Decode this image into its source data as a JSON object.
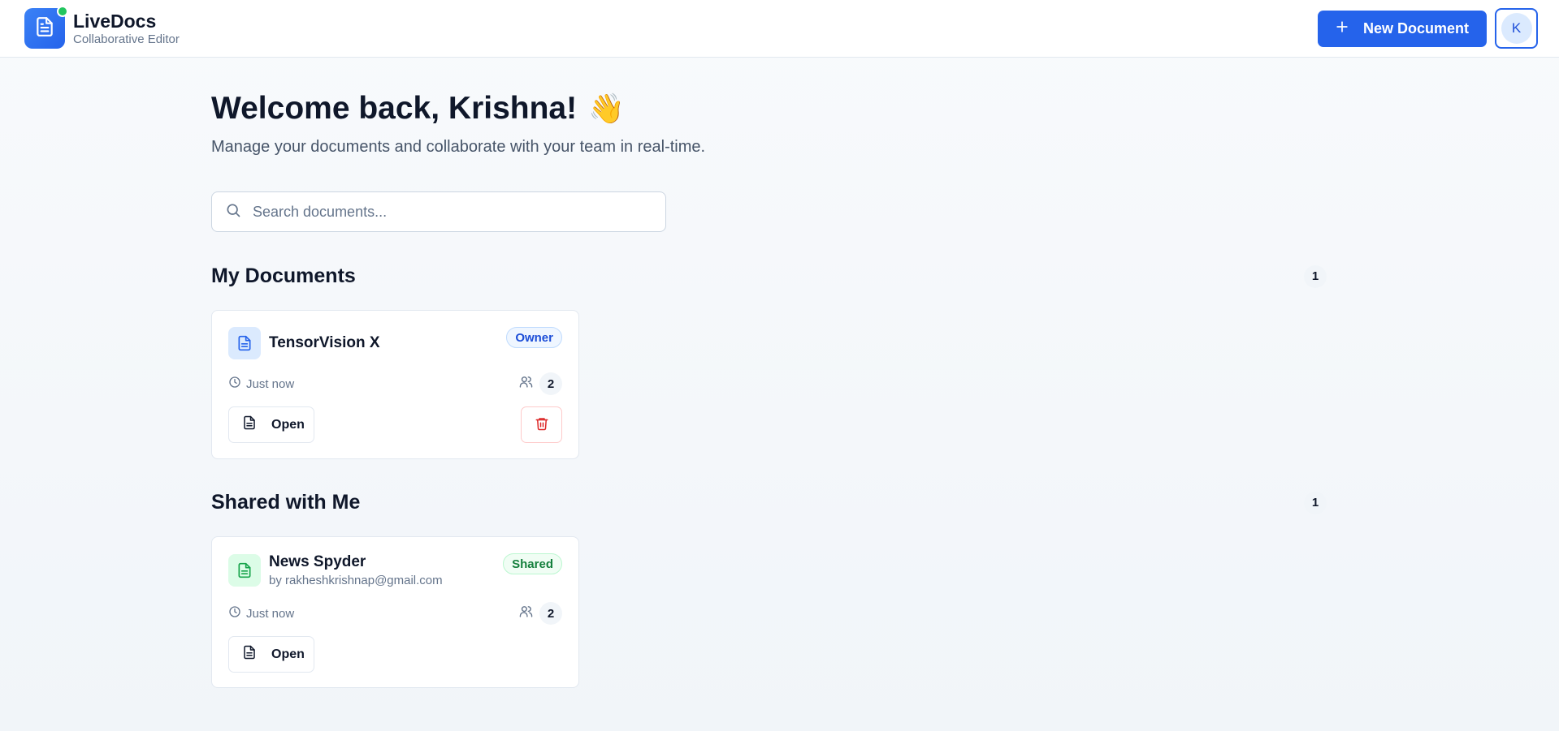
{
  "app": {
    "name": "LiveDocs",
    "subtitle": "Collaborative Editor"
  },
  "header": {
    "new_document_label": "New Document",
    "avatar_initial": "K"
  },
  "welcome": {
    "title": "Welcome back, Krishna!",
    "emoji": "👋",
    "subtitle": "Manage your documents and collaborate with your team in real-time."
  },
  "search": {
    "placeholder": "Search documents...",
    "value": ""
  },
  "my_documents": {
    "title": "My Documents",
    "count": "1",
    "items": [
      {
        "name": "TensorVision X",
        "role": "Owner",
        "time": "Just now",
        "collaborators": "2",
        "open_label": "Open"
      }
    ]
  },
  "shared_with_me": {
    "title": "Shared with Me",
    "count": "1",
    "items": [
      {
        "name": "News Spyder",
        "owner": "by rakheshkrishnap@gmail.com",
        "role": "Shared",
        "time": "Just now",
        "collaborators": "2",
        "open_label": "Open"
      }
    ]
  },
  "colors": {
    "accent": "#2563eb",
    "online": "#22c55e",
    "shared": "#15803d",
    "danger": "#dc2626"
  },
  "icons": [
    "file-text-icon",
    "plus-icon",
    "search-icon",
    "clock-icon",
    "users-icon",
    "trash-icon"
  ]
}
